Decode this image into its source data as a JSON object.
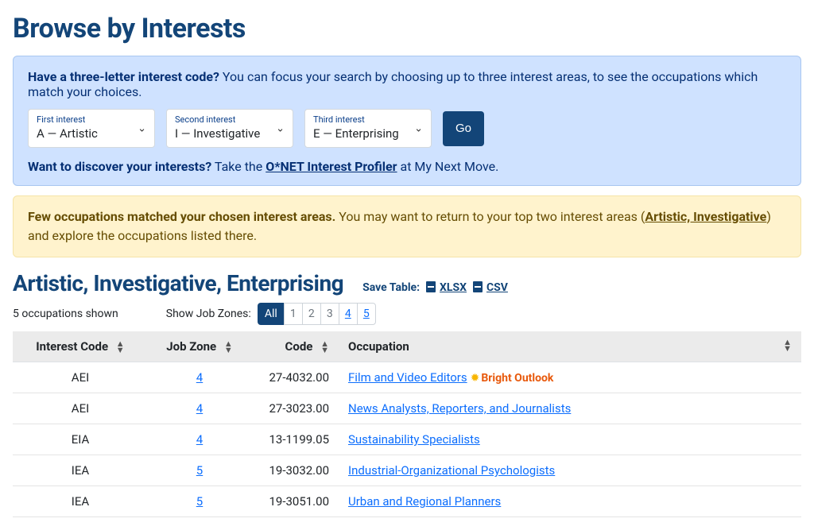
{
  "page_title": "Browse by Interests",
  "blue_panel": {
    "lead_bold": "Have a three-letter interest code?",
    "lead_rest": " You can focus your search by choosing up to three interest areas, to see the occupations which match your choices.",
    "selects": [
      {
        "label": "First interest",
        "value": "A — Artistic"
      },
      {
        "label": "Second interest",
        "value": "I — Investigative"
      },
      {
        "label": "Third interest",
        "value": "E — Enterprising"
      }
    ],
    "go": "Go",
    "discover_bold": "Want to discover your interests?",
    "discover_pre": " Take the ",
    "discover_link": "O*NET Interest Profiler",
    "discover_post": " at My Next Move."
  },
  "yellow_panel": {
    "bold": "Few occupations matched your chosen interest areas.",
    "pre": " You may want to return to your top two interest areas (",
    "link": "Artistic, Investigative",
    "post": ") and explore the occupations listed there."
  },
  "section_title": "Artistic, Investigative, Enterprising",
  "save_table": {
    "label": "Save Table:",
    "xlsx": "XLSX",
    "csv": "CSV"
  },
  "filter": {
    "count_text": "5 occupations shown",
    "zones_label": "Show Job Zones:",
    "buttons": [
      "All",
      "1",
      "2",
      "3",
      "4",
      "5"
    ],
    "active": "All",
    "links": [
      "4",
      "5"
    ]
  },
  "table": {
    "headers": {
      "interest_code": "Interest Code",
      "job_zone": "Job Zone",
      "code": "Code",
      "occupation": "Occupation"
    },
    "rows": [
      {
        "interest": "AEI",
        "zone": "4",
        "code": "27-4032.00",
        "occ": "Film and Video Editors",
        "bright": true
      },
      {
        "interest": "AEI",
        "zone": "4",
        "code": "27-3023.00",
        "occ": "News Analysts, Reporters, and Journalists",
        "bright": false
      },
      {
        "interest": "EIA",
        "zone": "4",
        "code": "13-1199.05",
        "occ": "Sustainability Specialists",
        "bright": false
      },
      {
        "interest": "IEA",
        "zone": "5",
        "code": "19-3032.00",
        "occ": "Industrial-Organizational Psychologists",
        "bright": false
      },
      {
        "interest": "IEA",
        "zone": "5",
        "code": "19-3051.00",
        "occ": "Urban and Regional Planners",
        "bright": false
      }
    ]
  },
  "bright_outlook": "Bright Outlook"
}
